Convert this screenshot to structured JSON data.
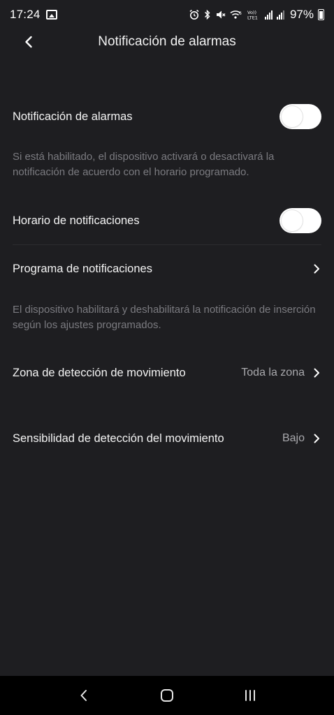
{
  "status_bar": {
    "time": "17:24",
    "battery": "97%",
    "icons": [
      "gallery-icon",
      "alarm-icon",
      "bluetooth-icon",
      "mute-icon",
      "wifi-icon",
      "volte-icon",
      "signal-icon",
      "battery-icon"
    ]
  },
  "header": {
    "title": "Notificación de alarmas",
    "back_icon": "chevron-left-icon"
  },
  "settings": {
    "alarm_notification": {
      "label": "Notificación de alarmas",
      "enabled": false,
      "description": "Si está habilitado, el dispositivo activará o desactivará la notificación de acuerdo con el horario programado."
    },
    "notification_schedule_toggle": {
      "label": "Horario de notificaciones",
      "enabled": false
    },
    "notification_program": {
      "label": "Programa de notificaciones",
      "description": "El dispositivo habilitará y deshabilitará la notificación de inserción según los ajustes programados."
    },
    "motion_zone": {
      "label": "Zona de detección de movimiento",
      "value": "Toda la zona"
    },
    "motion_sensitivity": {
      "label": "Sensibilidad de detección del movimiento",
      "value": "Bajo"
    }
  },
  "nav_bar": {
    "buttons": [
      "back-nav-icon",
      "home-icon",
      "recents-icon"
    ]
  },
  "colors": {
    "background": "#1e1e21",
    "text_primary": "#f4f4f4",
    "text_secondary": "#7b7b80",
    "value_text": "#a9a9ad",
    "toggle_off": "#ffffff"
  }
}
